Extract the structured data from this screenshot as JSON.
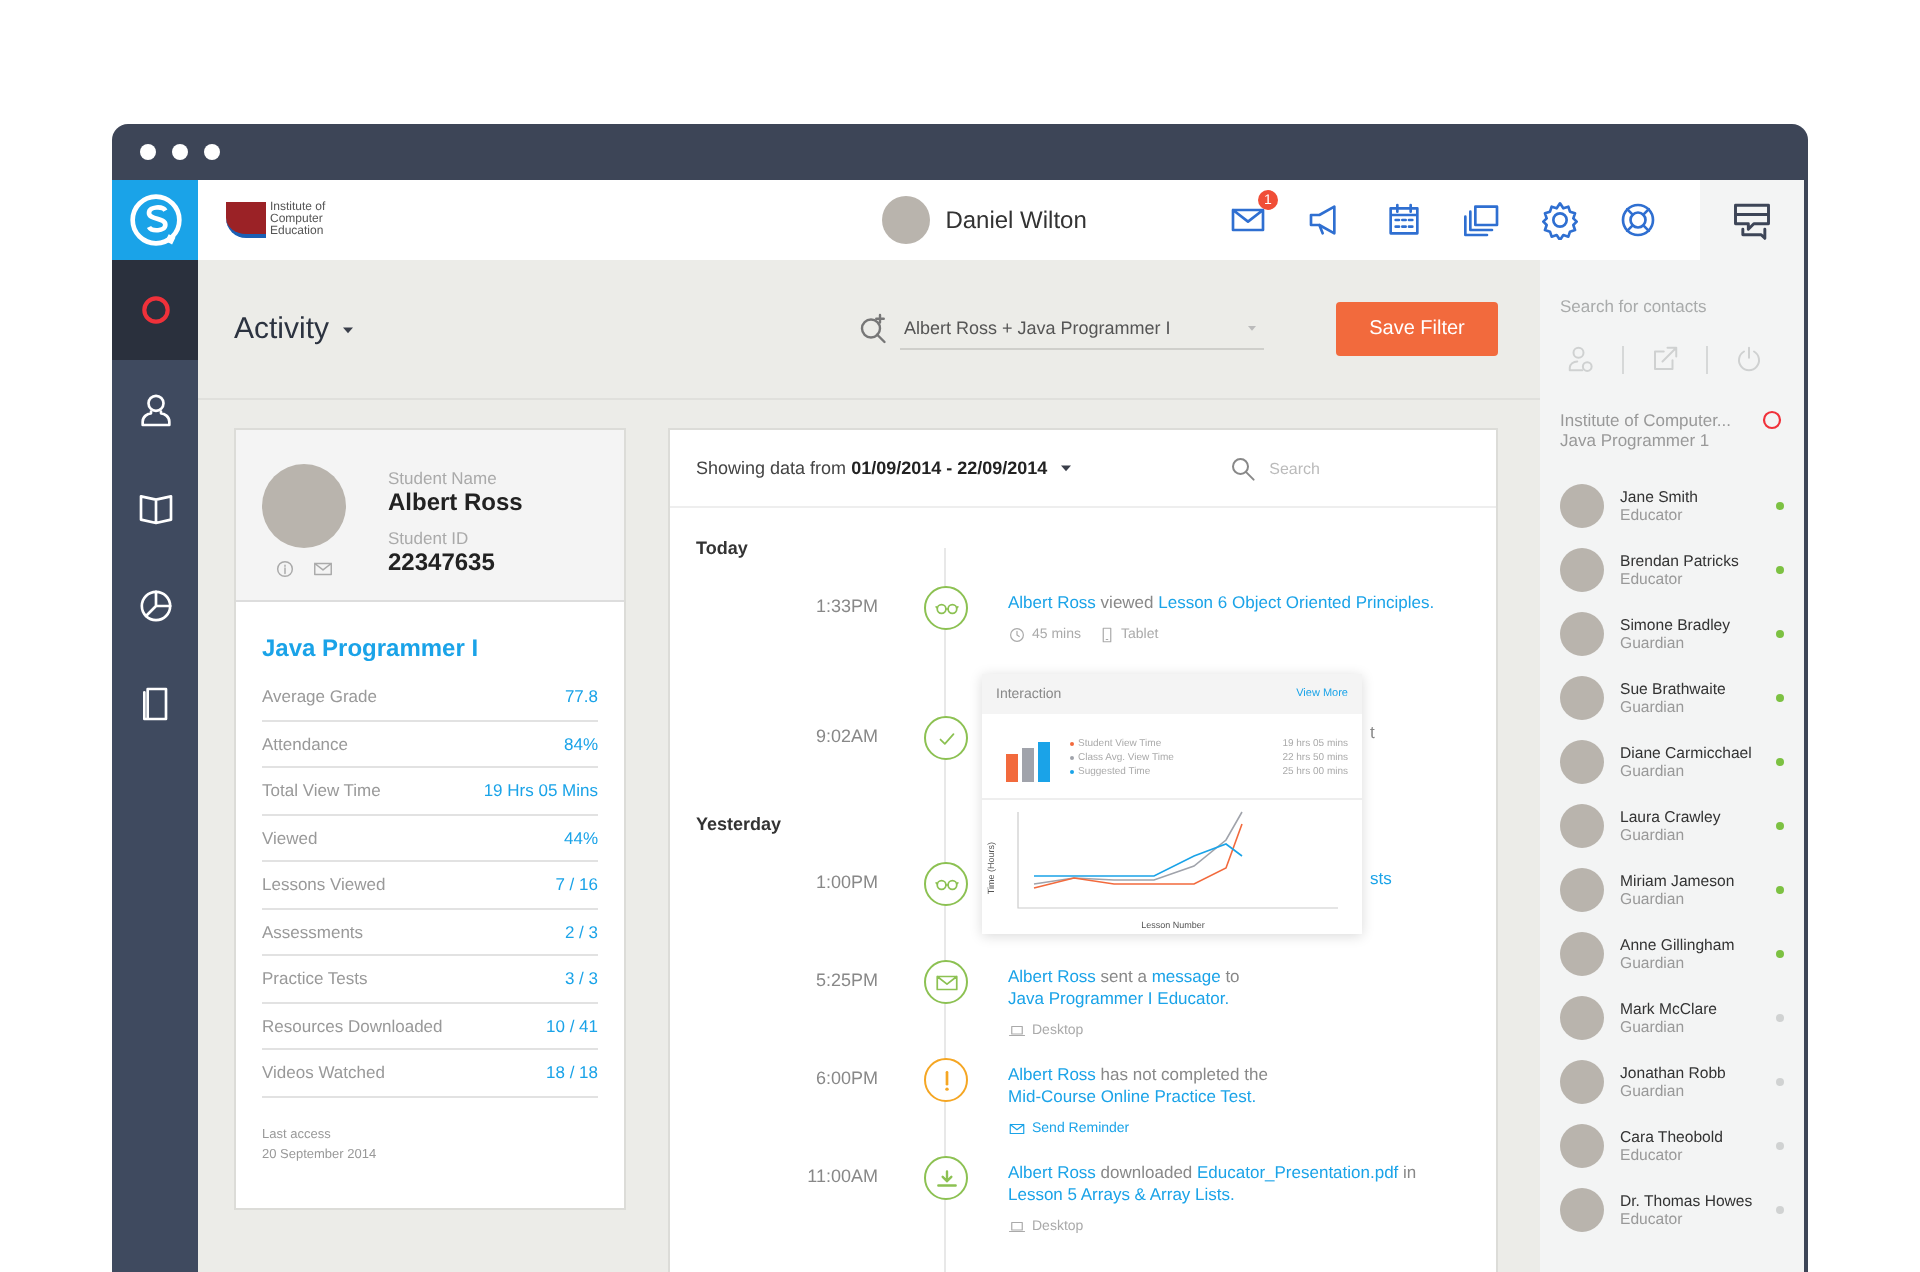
{
  "sidebar": {
    "items": [
      {
        "kind": "activity",
        "selected": true
      },
      {
        "kind": "user",
        "selected": false
      },
      {
        "kind": "book",
        "selected": false
      },
      {
        "kind": "chart",
        "selected": false
      },
      {
        "kind": "document",
        "selected": false
      }
    ]
  },
  "header": {
    "logo_lines": [
      "Institute of",
      "Computer",
      "Education"
    ],
    "user": "Daniel Wilton",
    "mail_count": "1"
  },
  "page": {
    "title": "Activity",
    "filter": "Albert Ross + Java Programmer I",
    "save_button": "Save Filter"
  },
  "student": {
    "name_label": "Student Name",
    "name": "Albert Ross",
    "id_label": "Student ID",
    "id": "22347635",
    "course": "Java Programmer I",
    "stats": [
      {
        "label": "Average Grade",
        "value": "77.8"
      },
      {
        "label": "Attendance",
        "value": "84%"
      },
      {
        "label": "Total View Time",
        "value": "19 Hrs 05 Mins"
      },
      {
        "label": "Viewed",
        "value": "44%"
      },
      {
        "label": "Lessons Viewed",
        "value": "7 / 16"
      },
      {
        "label": "Assessments",
        "value": "2 / 3"
      },
      {
        "label": "Practice Tests",
        "value": "3 / 3"
      },
      {
        "label": "Resources Downloaded",
        "value": "10 / 41"
      },
      {
        "label": "Videos Watched",
        "value": "18 / 18"
      }
    ],
    "last_access_label": "Last access",
    "last_access": "20 September 2014"
  },
  "activity": {
    "range_label": "Showing data from",
    "range": "01/09/2014 - 22/09/2014",
    "search_placeholder": "Search",
    "groups": [
      {
        "label": "Today",
        "items": [
          {
            "time": "1:33PM",
            "kind": "view",
            "covered": false,
            "parts": [
              {
                "text": "Albert Ross",
                "kind": "link"
              },
              {
                "text": " viewed ",
                "kind": "plain"
              },
              {
                "text": "Lesson 6 Object Oriented",
                "kind": "link"
              },
              {
                "text": "Principles.",
                "kind": "link"
              }
            ],
            "meta": [
              {
                "kind": "duration",
                "text": "45 mins"
              },
              {
                "kind": "tablet",
                "text": "Tablet"
              }
            ]
          },
          {
            "time": "9:02AM",
            "kind": "complete",
            "covered": true,
            "parts": [
              {
                "text": "t",
                "kind": "plain"
              }
            ]
          }
        ]
      },
      {
        "label": "Yesterday",
        "items": [
          {
            "time": "1:00PM",
            "kind": "view",
            "covered": true,
            "parts": [
              {
                "text": "sts",
                "kind": "link"
              }
            ]
          },
          {
            "time": "5:25PM",
            "kind": "message",
            "covered": false,
            "parts": [
              {
                "text": "Albert Ross",
                "kind": "link"
              },
              {
                "text": " sent a ",
                "kind": "plain"
              },
              {
                "text": "message",
                "kind": "link"
              },
              {
                "text": " to ",
                "kind": "plain"
              },
              {
                "text": "Java Programmer I",
                "kind": "link"
              },
              {
                "text": "Educator.",
                "kind": "link"
              }
            ],
            "meta": [
              {
                "kind": "desktop",
                "text": "Desktop"
              }
            ]
          },
          {
            "time": "6:00PM",
            "kind": "alert",
            "covered": false,
            "parts": [
              {
                "text": "Albert Ross",
                "kind": "link"
              },
              {
                "text": " has not completed the ",
                "kind": "plain"
              },
              {
                "text": "Mid-Course",
                "kind": "link"
              },
              {
                "text": "Online Practice Test.",
                "kind": "link"
              }
            ],
            "meta": [
              {
                "kind": "reminder",
                "text": "Send Reminder"
              }
            ]
          },
          {
            "time": "11:00AM",
            "kind": "download",
            "covered": false,
            "parts": [
              {
                "text": "Albert Ross",
                "kind": "link"
              },
              {
                "text": " downloaded ",
                "kind": "plain"
              },
              {
                "text": "Educator_Presentation.pdf",
                "kind": "link"
              },
              {
                "text": " in ",
                "kind": "plain"
              },
              {
                "text": "Lesson 5 Arrays & Array Lists.",
                "kind": "link"
              }
            ],
            "meta": [
              {
                "kind": "desktop",
                "text": "Desktop"
              }
            ]
          }
        ]
      }
    ]
  },
  "interaction": {
    "title": "Interaction",
    "link": "View More",
    "ylabel": "Time (Hours)",
    "xlabel": "Lesson Number",
    "legend": [
      {
        "label": "Student View Time",
        "value": "19 hrs 05 mins",
        "color": "#f26a3d"
      },
      {
        "label": "Class Avg. View Time",
        "value": "22 hrs 50 mins",
        "color": "#a0a3ab"
      },
      {
        "label": "Suggested Time",
        "value": "25 hrs 00 mins",
        "color": "#1aa3e8"
      }
    ]
  },
  "contacts": {
    "search_placeholder": "Search for contacts",
    "group_lines": [
      "Institute of Computer...",
      "Java Programmer 1"
    ],
    "items": [
      {
        "name": "Jane Smith",
        "role": "Educator",
        "online": true
      },
      {
        "name": "Brendan Patricks",
        "role": "Educator",
        "online": true
      },
      {
        "name": "Simone Bradley",
        "role": "Guardian",
        "online": true
      },
      {
        "name": "Sue Brathwaite",
        "role": "Guardian",
        "online": true
      },
      {
        "name": "Diane Carmicchael",
        "role": "Guardian",
        "online": true
      },
      {
        "name": "Laura Crawley",
        "role": "Guardian",
        "online": true
      },
      {
        "name": "Miriam Jameson",
        "role": "Guardian",
        "online": true
      },
      {
        "name": "Anne Gillingham",
        "role": "Guardian",
        "online": true
      },
      {
        "name": "Mark McClare",
        "role": "Guardian",
        "online": false
      },
      {
        "name": "Jonathan Robb",
        "role": "Guardian",
        "online": false
      },
      {
        "name": "Cara Theobold",
        "role": "Educator",
        "online": false
      },
      {
        "name": "Dr. Thomas Howes",
        "role": "Educator",
        "online": false
      }
    ]
  }
}
